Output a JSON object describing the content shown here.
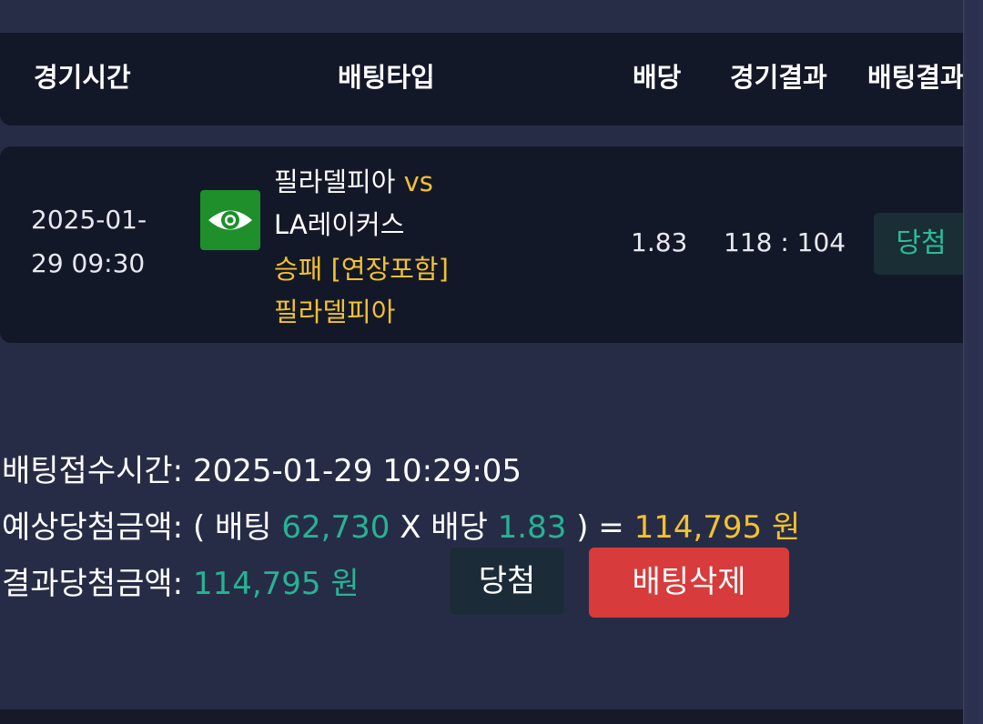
{
  "table_header": {
    "col_time": "경기시간",
    "col_bet_type": "배팅타입",
    "col_odds": "배당",
    "col_game_result": "경기결과",
    "col_bet_result": "배팅결과"
  },
  "bet": {
    "date": "2025-01-",
    "time": "29 09:30",
    "home_team": "필라델피아",
    "vs": "vs",
    "away_team": "LA레이커스",
    "market": "승패 [연장포함]",
    "pick": "필라델피아",
    "odds": "1.83",
    "score": "118 : 104",
    "result_badge": "당첨",
    "icon": "eye-icon"
  },
  "summary": {
    "received_label": "배팅접수시간:",
    "received_value": "2025-01-29 10:29:05",
    "expected_label": "예상당첨금액:",
    "expected_open": "( 배팅",
    "stake": "62,730",
    "times_odds": "X 배당",
    "odds": "1.83",
    "expected_close": ") =",
    "expected_amount": "114,795 원",
    "result_label": "결과당첨금액:",
    "result_amount": "114,795 원"
  },
  "actions": {
    "win_label": "당첨",
    "delete_label": "배팅삭제"
  },
  "colors": {
    "background": "#272c46",
    "row_background": "#131829",
    "accent_gold": "#f2c12e",
    "accent_teal": "#26b394",
    "danger": "#d83b3b",
    "eye_green": "#1e8f2b"
  }
}
